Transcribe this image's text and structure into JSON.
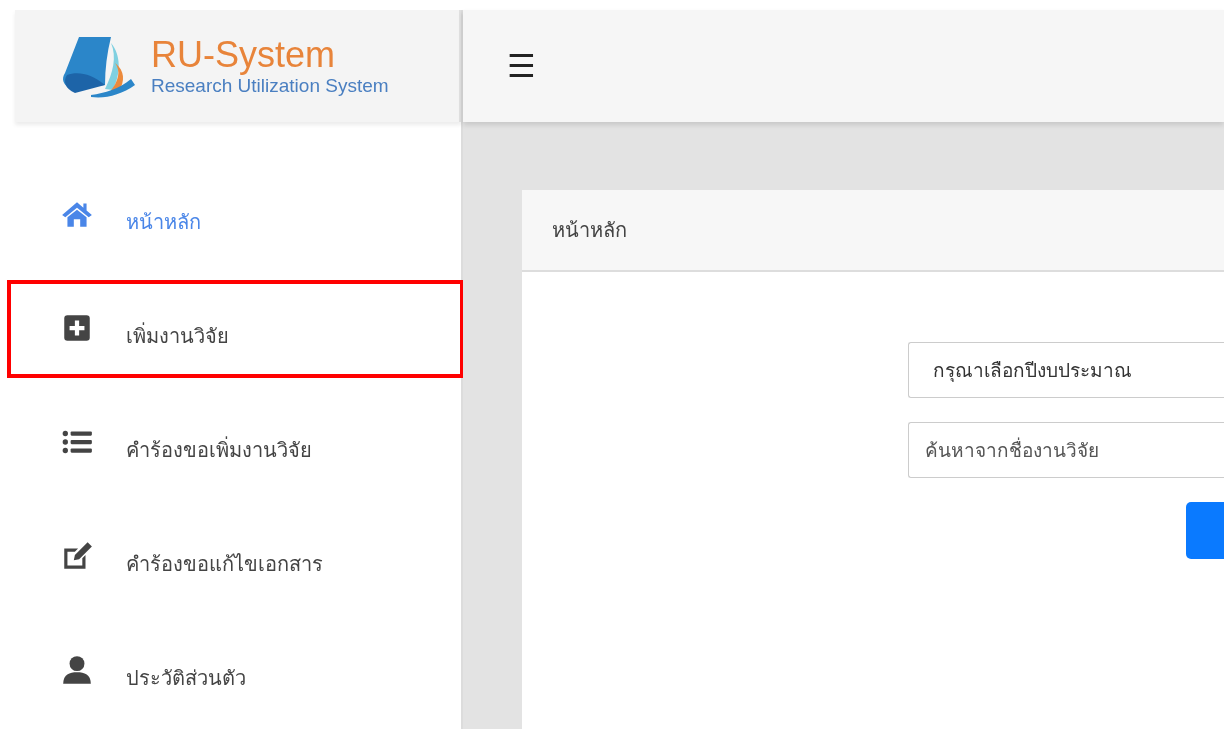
{
  "brand": {
    "title": "RU-System",
    "subtitle": "Research Utilization System"
  },
  "topbar": {
    "menu_icon": "☰"
  },
  "sidebar": {
    "items": [
      {
        "label": "หน้าหลัก",
        "kind": "home",
        "selected": true,
        "highlighted": false
      },
      {
        "label": "เพิ่มงานวิจัย",
        "kind": "add",
        "selected": false,
        "highlighted": true
      },
      {
        "label": "คำร้องขอเพิ่มงานวิจัย",
        "kind": "list",
        "selected": false,
        "highlighted": false
      },
      {
        "label": "คำร้องขอแก้ไขเอกสาร",
        "kind": "edit",
        "selected": false,
        "highlighted": false
      },
      {
        "label": "ประวัติส่วนตัว",
        "kind": "user",
        "selected": false,
        "highlighted": false
      }
    ]
  },
  "card": {
    "title": "หน้าหลัก",
    "year_select": {
      "value": "กรุณาเลือกปีงบประมาณ"
    },
    "search": {
      "placeholder": "ค้นหาจากชื่องานวิจัย"
    }
  }
}
